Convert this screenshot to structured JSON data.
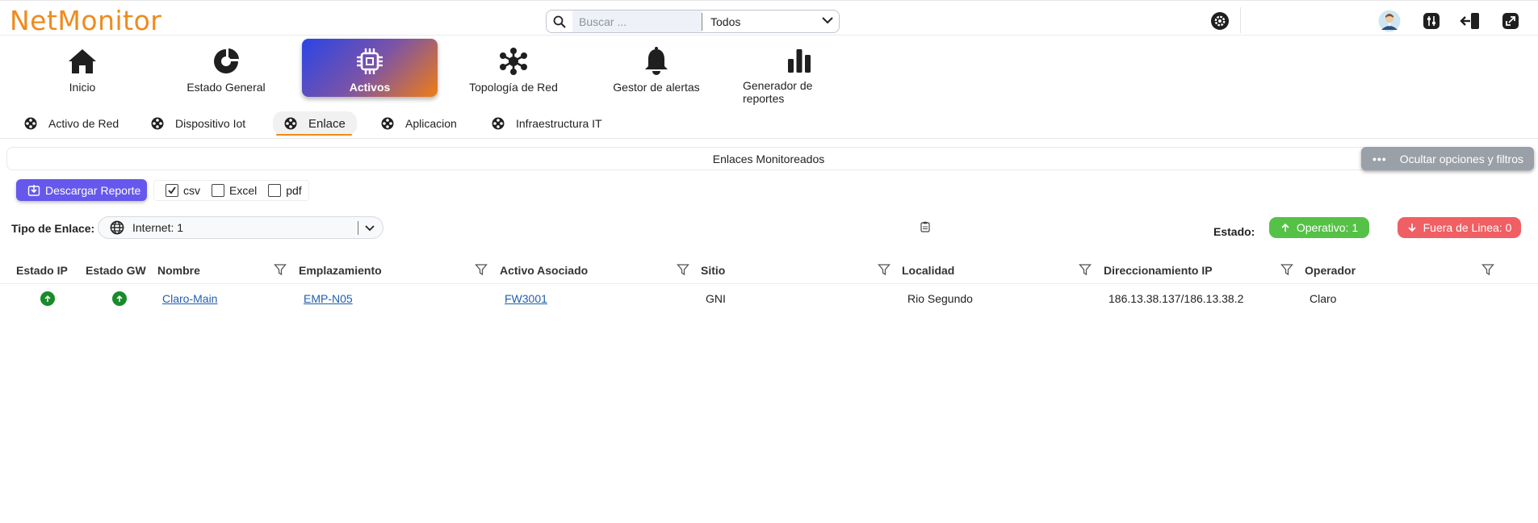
{
  "app": {
    "name": "NetMonitor"
  },
  "header": {
    "search_placeholder": "Buscar ...",
    "search_value": "",
    "scope_selected": "Todos"
  },
  "main_nav": [
    {
      "label": "Inicio",
      "icon": "home-icon",
      "active": false
    },
    {
      "label": "Estado General",
      "icon": "pie-chart-icon",
      "active": false
    },
    {
      "label": "Activos",
      "icon": "chip-icon",
      "active": true
    },
    {
      "label": "Topología de Red",
      "icon": "network-topology-icon",
      "active": false
    },
    {
      "label": "Gestor de alertas",
      "icon": "bell-icon",
      "active": false
    },
    {
      "label": "Generador de reportes",
      "icon": "bar-chart-icon",
      "active": false
    }
  ],
  "sub_tabs": [
    {
      "label": "Activo de Red",
      "active": false
    },
    {
      "label": "Dispositivo Iot",
      "active": false
    },
    {
      "label": "Enlace",
      "active": true
    },
    {
      "label": "Aplicacion",
      "active": false
    },
    {
      "label": "Infraestructura IT",
      "active": false
    }
  ],
  "section": {
    "title": "Enlaces Monitoreados",
    "options_button": "Ocultar opciones y filtros"
  },
  "download": {
    "button": "Descargar Reporte",
    "formats": [
      {
        "label": "csv",
        "checked": true
      },
      {
        "label": "Excel",
        "checked": false
      },
      {
        "label": "pdf",
        "checked": false
      }
    ]
  },
  "filters": {
    "tipo_label": "Tipo de Enlace:",
    "tipo_value": "Internet: 1",
    "estado_label": "Estado:",
    "operativo": "Operativo: 1",
    "fuera_de_linea": "Fuera de Linea: 0",
    "colors": {
      "operativo": "#55c146",
      "fuera_de_linea": "#f05f63"
    }
  },
  "table": {
    "columns": [
      "Estado IP",
      "Estado GW",
      "Nombre",
      "Emplazamiento",
      "Activo Asociado",
      "Sitio",
      "Localidad",
      "Direccionamiento IP",
      "Operador"
    ],
    "rows": [
      {
        "estado_ip": "up",
        "estado_gw": "up",
        "nombre": "Claro-Main",
        "emplazamiento": "EMP-N05",
        "activo": "FW3001",
        "sitio": "GNI",
        "localidad": "Rio Segundo",
        "ip": "186.13.38.137/186.13.38.2",
        "operador": "Claro"
      }
    ]
  },
  "colors": {
    "brand": "#f08a1c",
    "primary_button": "#6658ec",
    "link": "#1f5fb0",
    "status_up": "#1a8a2a"
  }
}
